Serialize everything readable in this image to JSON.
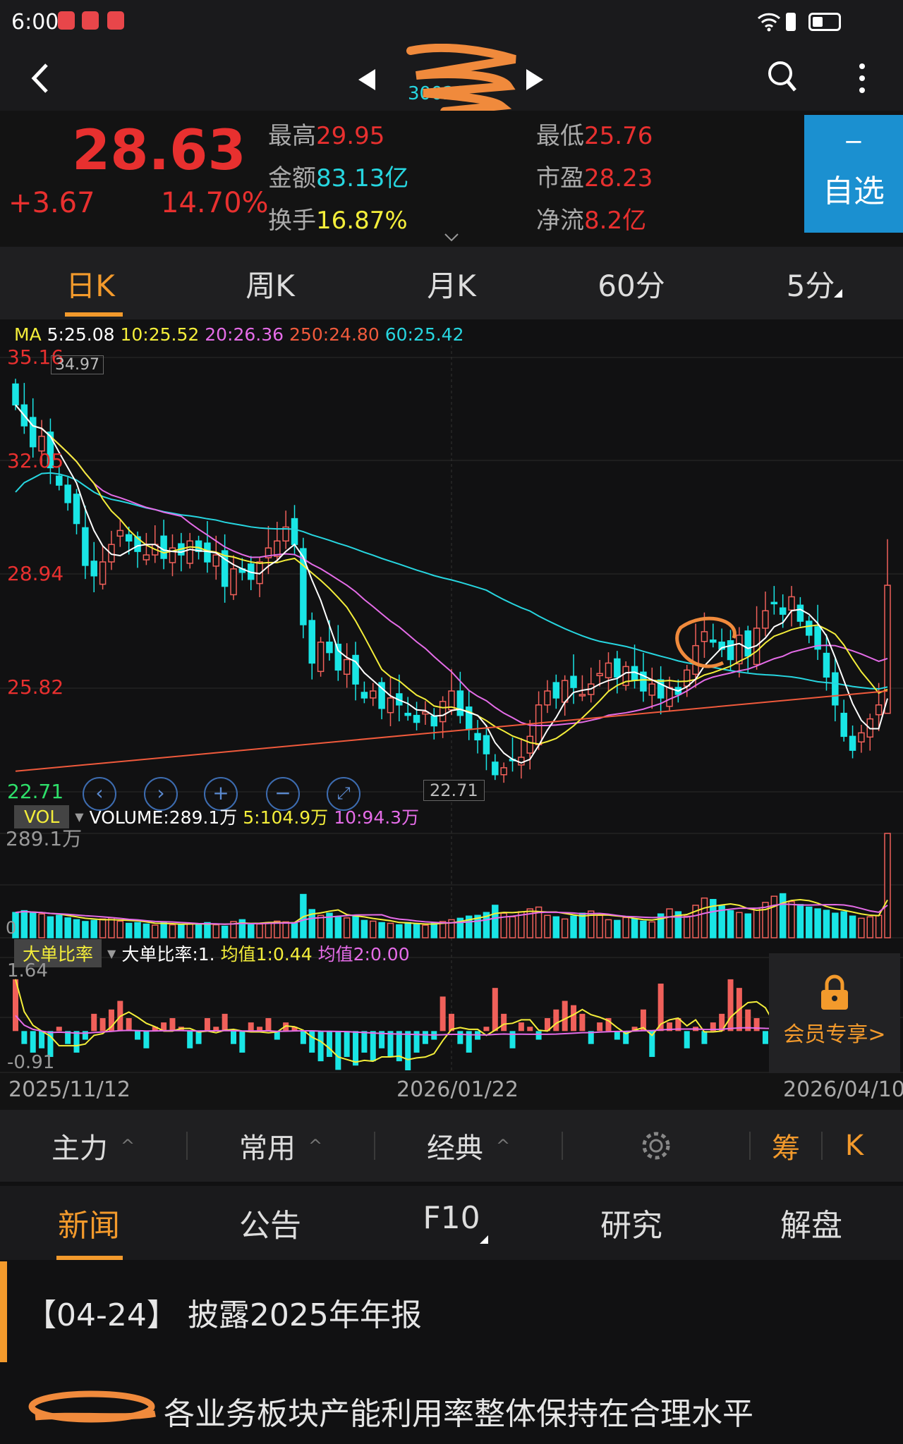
{
  "status_bar": {
    "time": "6:00"
  },
  "header": {
    "stock_code": "30020"
  },
  "quote": {
    "price": "28.63",
    "change": "+3.67",
    "change_pct": "14.70%",
    "high_label": "最高",
    "high": "29.95",
    "low_label": "最低",
    "low": "25.76",
    "amount_label": "金额",
    "amount": "83.13亿",
    "pe_label": "市盈",
    "pe": "28.23",
    "turnover_label": "换手",
    "turnover": "16.87%",
    "netflow_label": "净流",
    "netflow": "8.2亿",
    "watch_minus": "−",
    "watch_label": "自选"
  },
  "period_tabs": [
    {
      "label": "日K"
    },
    {
      "label": "周K"
    },
    {
      "label": "月K"
    },
    {
      "label": "60分"
    },
    {
      "label": "5分"
    }
  ],
  "ma_legend": {
    "ma": "MA",
    "ma5": "5:25.08",
    "ma10": "10:25.52",
    "ma20": "20:26.36",
    "ma250": "250:24.80",
    "ma60": "60:25.42"
  },
  "price_axis": [
    "35.16",
    "32.05",
    "28.94",
    "25.82",
    "22.71"
  ],
  "markers": {
    "high": "34.97",
    "low": "22.71"
  },
  "vol_legend": {
    "tag": "VOL",
    "volume": "VOLUME:289.1万",
    "ma5": "5:104.9万",
    "ma10": "10:94.3万",
    "max": "289.1万",
    "zero": "0"
  },
  "ratio_legend": {
    "tag": "大单比率",
    "value": "大单比率:1.",
    "avg1": "均值1:0.44",
    "avg2": "均值2:0.00",
    "max": "1.64",
    "min": "-0.91"
  },
  "member_lock": {
    "label": "会员专享>"
  },
  "dates": [
    "2025/11/12",
    "2026/01/22",
    "2026/04/10"
  ],
  "toolbar": {
    "main": "主力",
    "common": "常用",
    "classic": "经典",
    "chips": "筹",
    "k": "K"
  },
  "news_tabs": [
    {
      "label": "新闻"
    },
    {
      "label": "公告"
    },
    {
      "label": "F10"
    },
    {
      "label": "研究"
    },
    {
      "label": "解盘"
    }
  ],
  "news": [
    {
      "text": "【04-24】 披露2025年年报"
    },
    {
      "text": "各业务板块产能利用率整体保持在合理水平"
    }
  ],
  "colors": {
    "up": "#f0605a",
    "down": "#19e5e5",
    "accent": "#f39a2c",
    "blue": "#1b90d0",
    "ma5": "#ffffff",
    "ma10": "#f4ee3a",
    "ma20": "#e56ce8",
    "ma60": "#27d6e0",
    "ma250": "#f05a3c"
  },
  "chart_data": {
    "type": "candlestick",
    "ylim": [
      22.71,
      35.16
    ],
    "closes": [
      33.8,
      33.2,
      32.6,
      32.9,
      32.0,
      31.5,
      31.0,
      30.4,
      29.2,
      28.9,
      29.3,
      29.8,
      30.2,
      29.9,
      29.6,
      29.5,
      29.8,
      29.4,
      29.7,
      29.5,
      29.9,
      29.6,
      29.3,
      29.5,
      28.6,
      29.1,
      29.0,
      28.8,
      29.3,
      29.7,
      29.9,
      30.3,
      29.8,
      27.5,
      26.4,
      27.0,
      26.7,
      26.2,
      26.5,
      25.8,
      25.4,
      25.6,
      25.1,
      25.4,
      25.2,
      24.9,
      24.7,
      25.0,
      24.6,
      25.3,
      25.6,
      24.9,
      24.5,
      24.2,
      23.8,
      23.2,
      23.4,
      23.6,
      23.7,
      24.3,
      25.2,
      25.6,
      25.4,
      25.9,
      25.7,
      25.5,
      25.8,
      26.1,
      26.4,
      26.0,
      26.3,
      25.9,
      25.6,
      25.8,
      25.4,
      25.7,
      25.5,
      26.2,
      26.9,
      27.3,
      27.0,
      26.8,
      26.5,
      27.2,
      26.6,
      27.4,
      27.9,
      28.1,
      27.8,
      28.3,
      27.6,
      27.2,
      26.8,
      26.0,
      25.2,
      24.3,
      23.9,
      24.4,
      24.8,
      25.2,
      28.63
    ],
    "ma250_range": [
      23.3,
      25.6
    ],
    "volume": [
      70,
      75,
      68,
      66,
      58,
      62,
      55,
      50,
      45,
      48,
      52,
      55,
      46,
      40,
      42,
      38,
      35,
      44,
      36,
      35,
      40,
      38,
      42,
      36,
      32,
      45,
      50,
      36,
      38,
      42,
      46,
      44,
      40,
      120,
      78,
      62,
      68,
      58,
      55,
      60,
      48,
      46,
      42,
      40,
      36,
      42,
      38,
      35,
      40,
      45,
      50,
      54,
      60,
      62,
      70,
      90,
      68,
      58,
      72,
      80,
      85,
      62,
      58,
      52,
      60,
      68,
      74,
      62,
      50,
      48,
      56,
      52,
      46,
      44,
      66,
      80,
      72,
      60,
      90,
      110,
      106,
      88,
      75,
      70,
      66,
      82,
      98,
      115,
      122,
      100,
      92,
      85,
      80,
      76,
      68,
      72,
      60,
      54,
      58,
      62,
      289.1
    ],
    "volume_max": 289.1,
    "big_order_ratio": [
      1.2,
      -0.3,
      -0.5,
      -0.4,
      -0.6,
      0.1,
      -0.3,
      -0.5,
      -0.2,
      0.4,
      0.3,
      0.5,
      0.7,
      0.3,
      -0.2,
      -0.4,
      0.1,
      0.2,
      0.3,
      0.1,
      -0.4,
      -0.3,
      0.3,
      0.1,
      0.4,
      -0.3,
      -0.5,
      0.2,
      0.1,
      0.3,
      -0.2,
      0.2,
      0.1,
      -0.3,
      -0.5,
      -0.7,
      -0.6,
      -0.9,
      -0.6,
      -0.8,
      -0.5,
      -0.7,
      -0.4,
      -0.6,
      -0.7,
      -0.91,
      -0.5,
      -0.3,
      -0.2,
      0.8,
      0.4,
      -0.3,
      -0.5,
      -0.2,
      0.1,
      1.0,
      0.4,
      -0.4,
      0.2,
      0.1,
      -0.2,
      0.3,
      0.5,
      0.7,
      0.6,
      0.4,
      -0.3,
      0.2,
      0.3,
      -0.2,
      -0.3,
      0.1,
      0.5,
      -0.6,
      1.1,
      0.2,
      0.3,
      -0.4,
      0.1,
      -0.3,
      0.2,
      0.4,
      1.2,
      1.0,
      0.5,
      0.3,
      -0.3,
      -0.6,
      -0.4,
      0.8,
      0.7,
      0.6,
      0.5,
      0.3,
      0.1,
      -0.2,
      0.2,
      0.4,
      0.6,
      0.3,
      0.5
    ],
    "ratio_range": [
      -0.91,
      1.64
    ]
  }
}
